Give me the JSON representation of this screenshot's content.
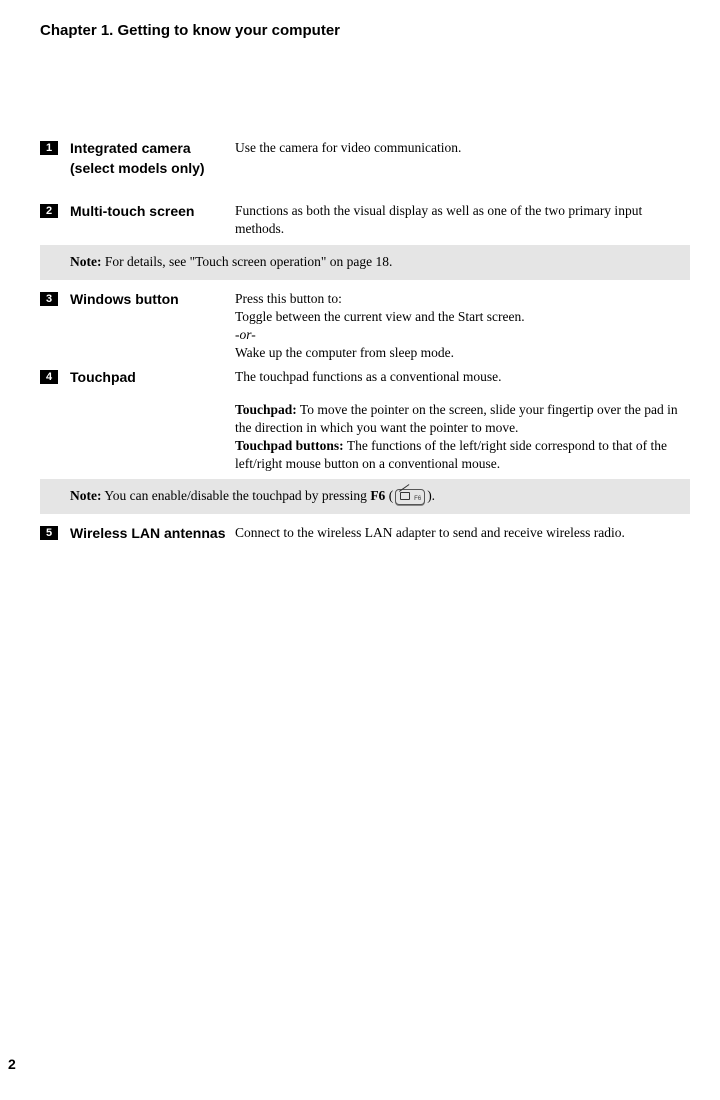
{
  "chapter_title": "Chapter 1. Getting to know your computer",
  "items": [
    {
      "num": "1",
      "term": "Integrated camera (select models only)",
      "desc": "Use the camera for video communication."
    },
    {
      "num": "2",
      "term": "Multi-touch screen",
      "desc": "Functions as both the visual display as well as one of the two primary input methods."
    },
    {
      "num": "3",
      "term": "Windows button",
      "desc_intro": "Press this button to:",
      "desc_line1": "Toggle between the current view and the Start screen.",
      "desc_or": "-or-",
      "desc_line2": "Wake up the computer from sleep mode."
    },
    {
      "num": "4",
      "term": "Touchpad",
      "desc_intro": "The touchpad functions as a conventional mouse.",
      "tp_label": "Touchpad:",
      "tp_text": " To move the pointer on the screen, slide your fingertip over the pad in the direction in which you want the pointer to move.",
      "tb_label": "Touchpad buttons:",
      "tb_text": " The functions of the left/right side correspond to that of the left/right mouse button on a conventional mouse."
    },
    {
      "num": "5",
      "term": "Wireless LAN antennas",
      "desc": "Connect to the wireless LAN adapter to send and receive wireless radio."
    }
  ],
  "note1": {
    "label": "Note:",
    "text": "  For details, see \"Touch screen operation\" on page 18."
  },
  "note2": {
    "label": "Note:",
    "text_before": " You can enable/disable the touchpad by pressing ",
    "f6": "F6",
    "text_paren_open": " (",
    "keycap_sub": "F6",
    "text_paren_close": ")."
  },
  "page_number": "2"
}
